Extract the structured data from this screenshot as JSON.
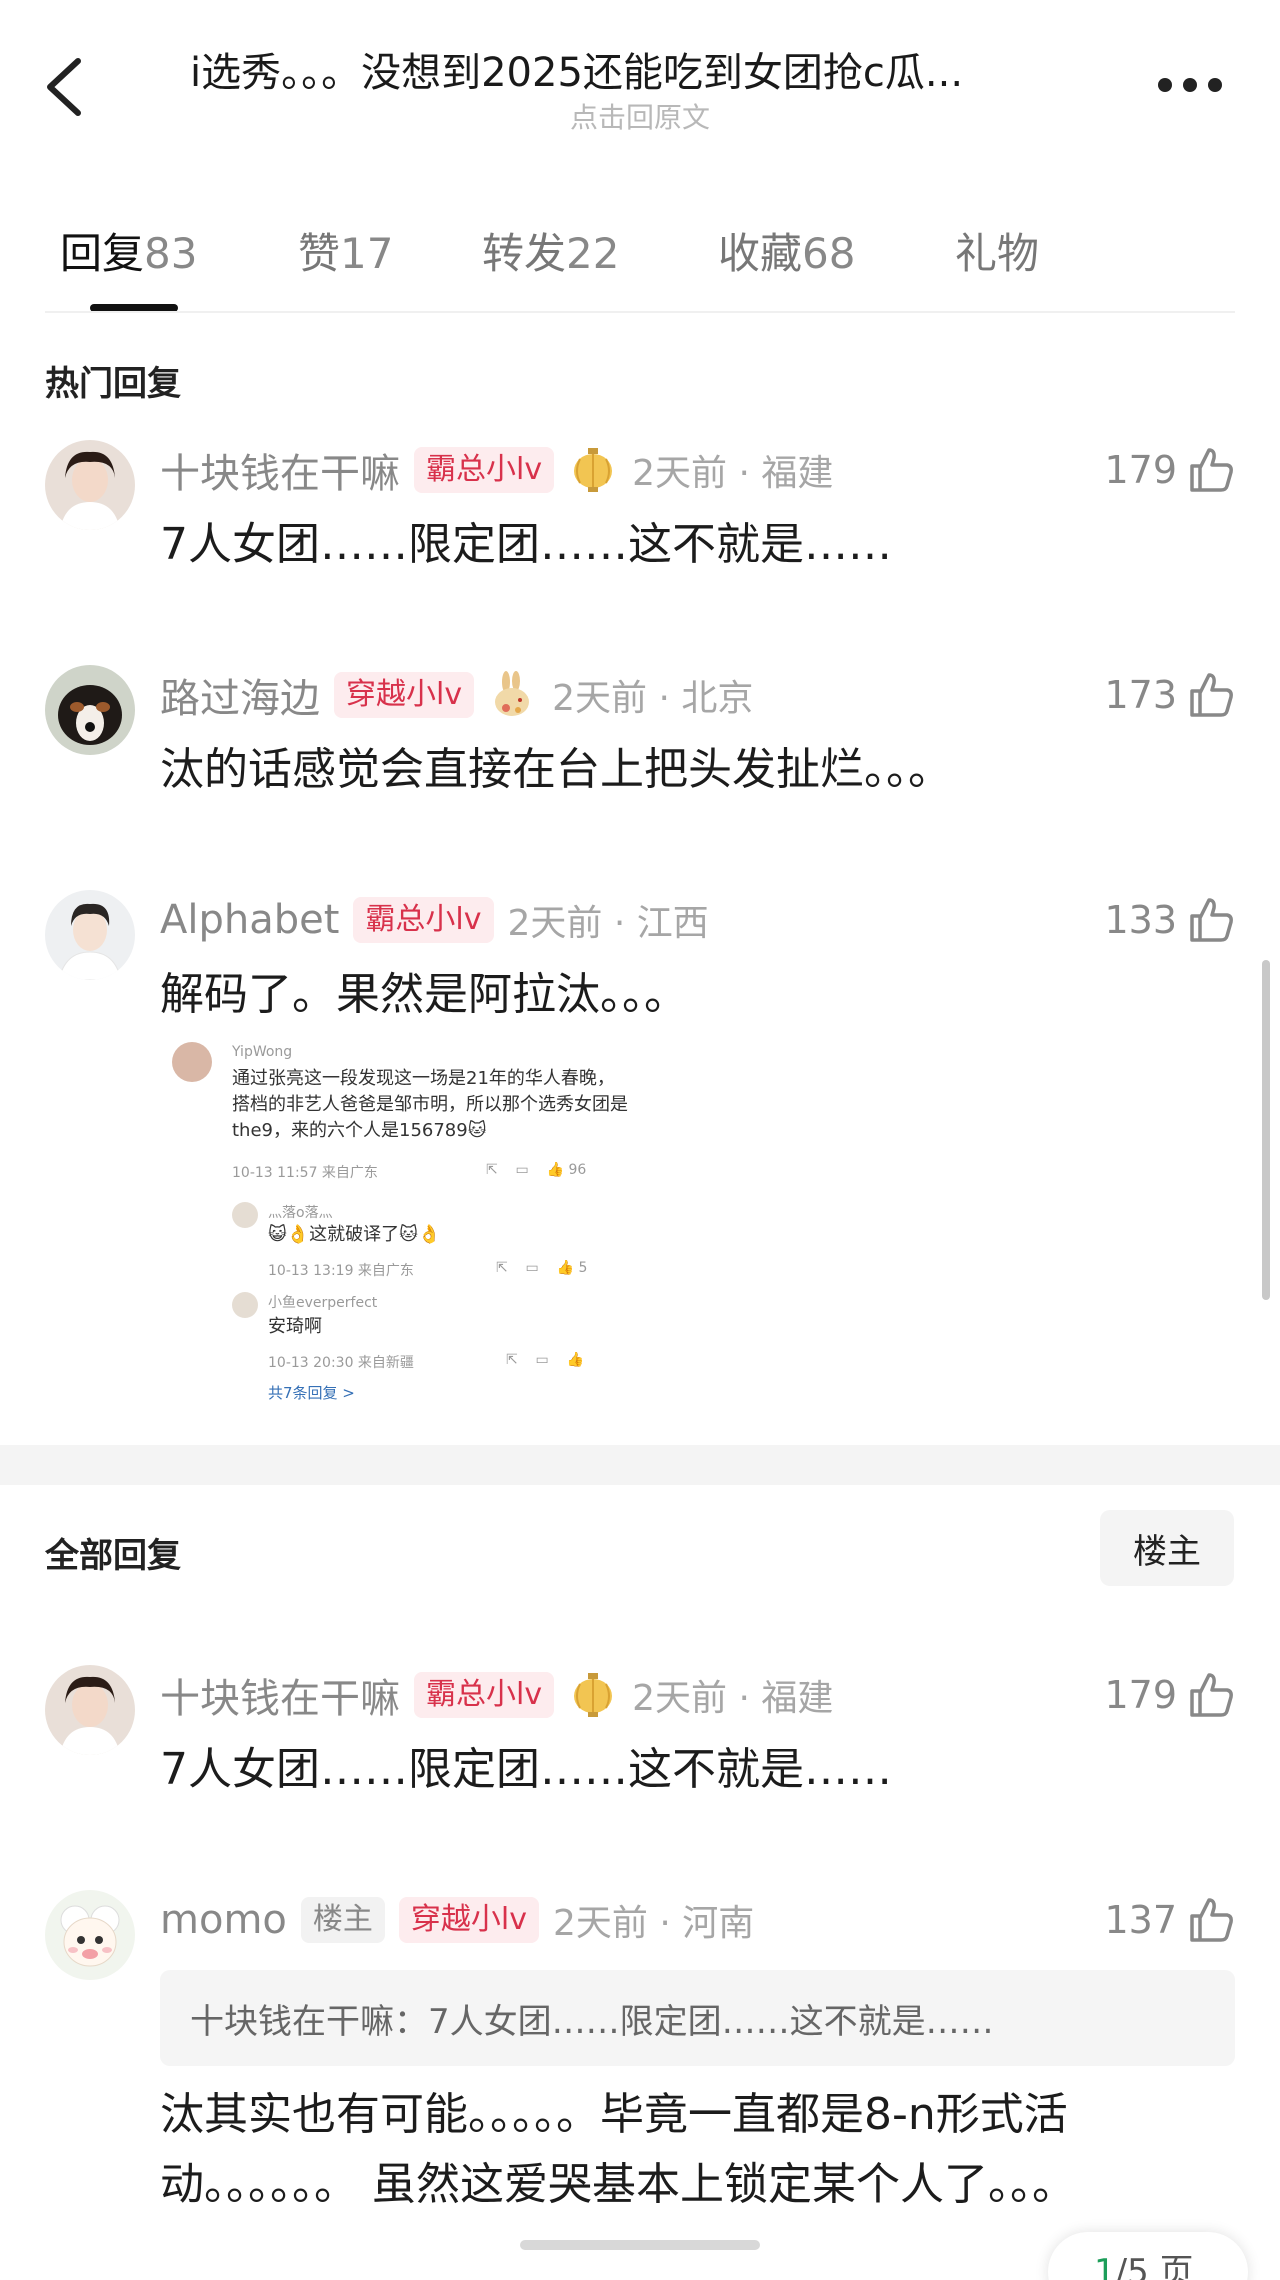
{
  "header": {
    "title": "i选秀。。。没想到2025还能吃到女团抢c瓜...",
    "subtitle": "点击回原文"
  },
  "tabs": [
    {
      "label": "回复",
      "count": "83"
    },
    {
      "label": "赞",
      "count": "17"
    },
    {
      "label": "转发",
      "count": "22"
    },
    {
      "label": "收藏",
      "count": "68"
    },
    {
      "label": "礼物",
      "count": ""
    }
  ],
  "hot_section_title": "热门回复",
  "all_section_title": "全部回复",
  "owner_filter_label": "楼主",
  "hot_comments": [
    {
      "username": "十块钱在干嘛",
      "badge": "霸总小lv",
      "badge_icon": "lantern-icon",
      "time_loc": "2天前 · 福建",
      "likes": "179",
      "text": "7人女团……限定团……这不就是……"
    },
    {
      "username": "路过海边",
      "badge": "穿越小lv",
      "badge_icon": "rabbit-icon",
      "time_loc": "2天前 · 北京",
      "likes": "173",
      "text": "汰的话感觉会直接在台上把头发扯烂。。。"
    },
    {
      "username": "Alphabet",
      "badge": "霸总小lv",
      "badge_icon": "",
      "time_loc": "2天前 · 江西",
      "likes": "133",
      "text": "解码了。果然是阿拉汰。。。"
    }
  ],
  "embedded_screenshot": {
    "author": "YipWong",
    "text": "通过张亮这一段发现这一场是21年的华人春晚，搭档的非艺人爸爸是邹市明，所以那个选秀女团是the9，来的六个人是156789🐱",
    "meta": "10-13 11:57  来自广东",
    "likes": "96",
    "reply1_author": "灬落o落灬",
    "reply1_text": "😺👌这就破译了🐱👌",
    "reply1_meta": "10-13 13:19  来自广东",
    "reply1_likes": "5",
    "reply2_author": "小鱼everperfect",
    "reply2_text": "安琦啊",
    "reply2_meta": "10-13 20:30  来自新疆",
    "more_replies": "共7条回复 >"
  },
  "all_comments": [
    {
      "username": "十块钱在干嘛",
      "badge": "霸总小lv",
      "badge_icon": "lantern-icon",
      "time_loc": "2天前 · 福建",
      "likes": "179",
      "text": "7人女团……限定团……这不就是……"
    },
    {
      "username": "momo",
      "owner_badge": "楼主",
      "badge": "穿越小lv",
      "time_loc": "2天前 · 河南",
      "likes": "137",
      "quote": "十块钱在干嘛：7人女团……限定团……这不就是……",
      "text": "汰其实也有可能。。。。。毕竟一直都是8-n形式活动。。。。。。  虽然这爱哭基本上锁定某个人了。。。"
    }
  ],
  "pager": {
    "current": "1",
    "total": "/5 页"
  }
}
